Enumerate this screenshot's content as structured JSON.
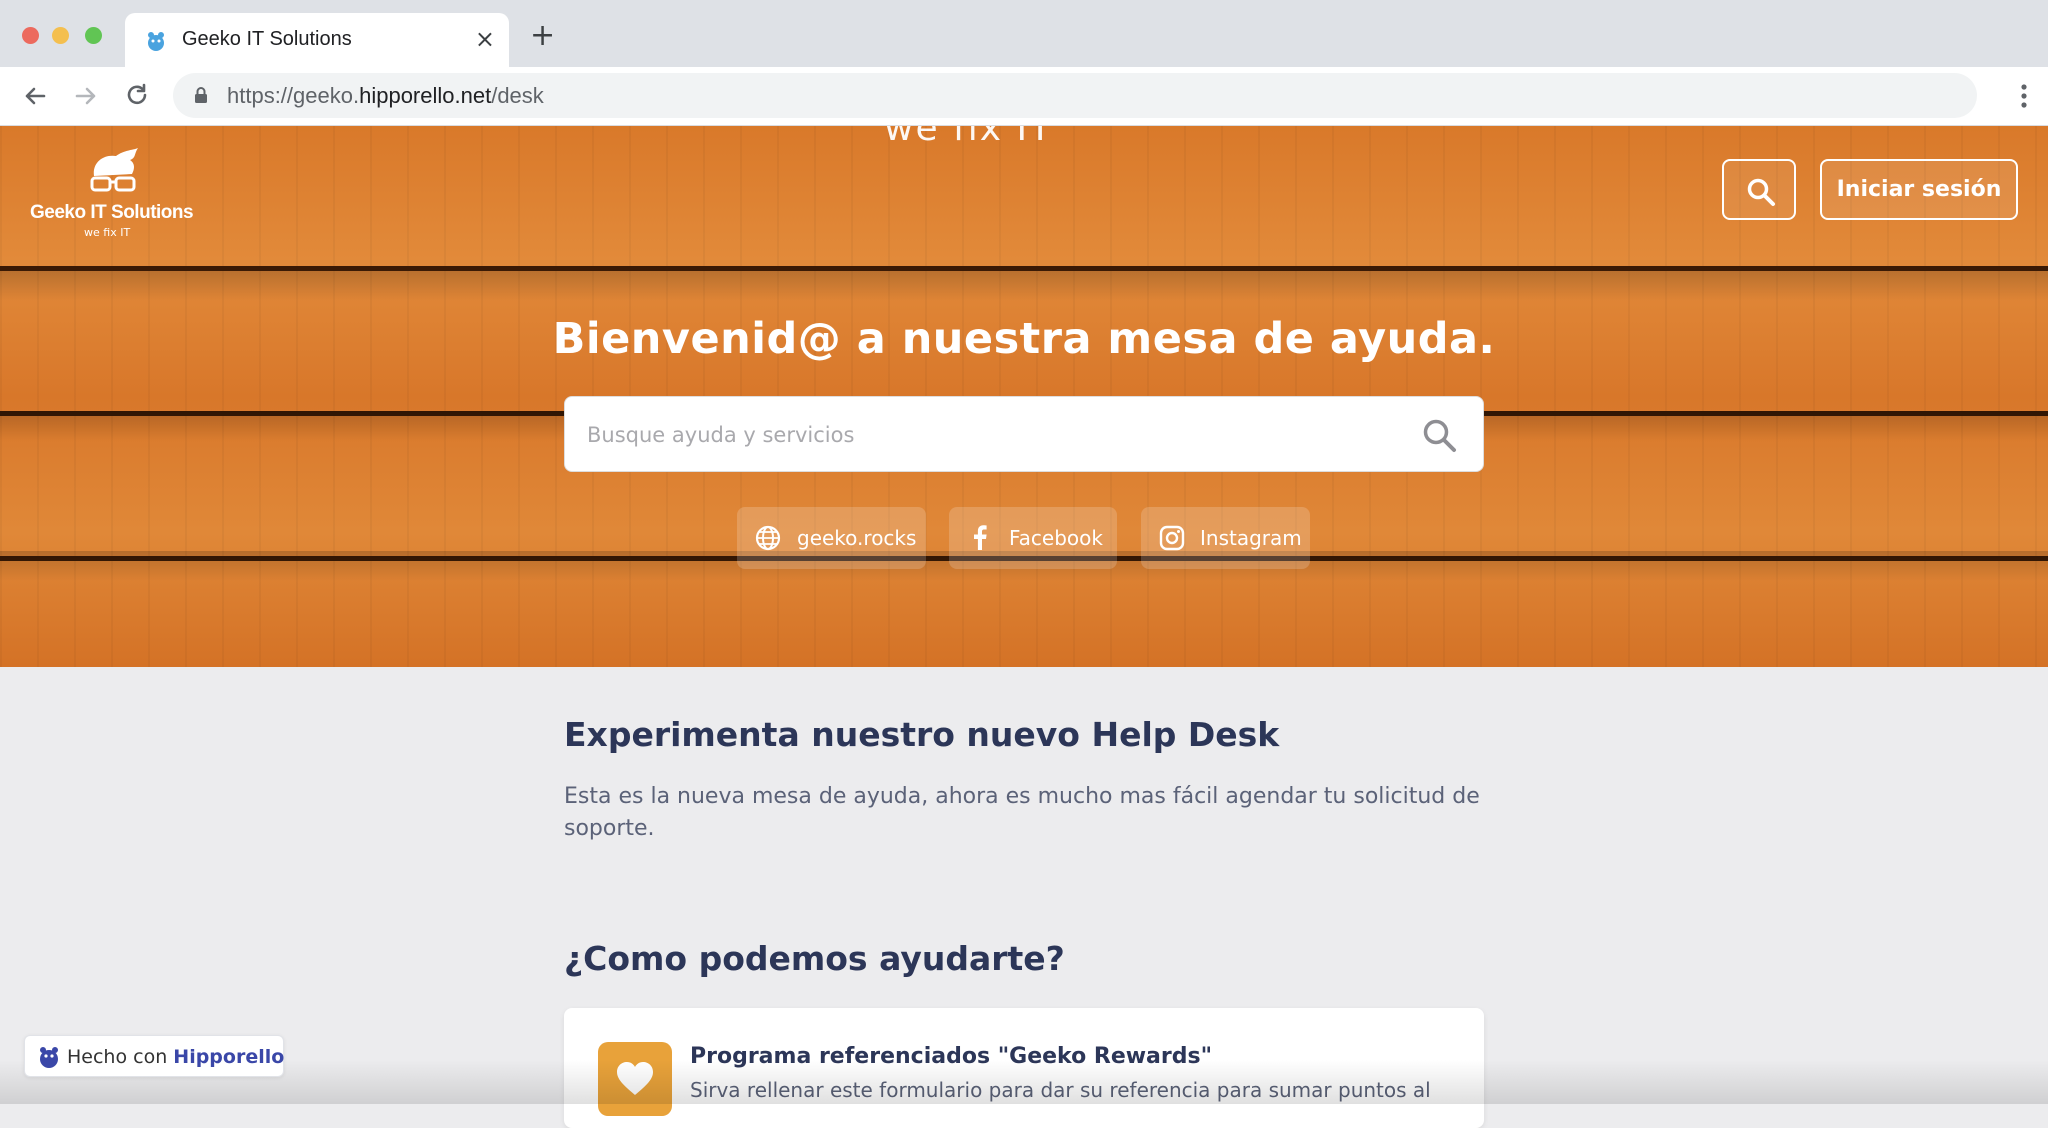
{
  "browser": {
    "tab_title": "Geeko IT Solutions",
    "tab_close": "×",
    "new_tab": "+",
    "url_prefix": "https://geeko.",
    "url_domain": "hipporello.net",
    "url_path": "/desk"
  },
  "header": {
    "slogan_top": "we fix IT",
    "logo_name": "Geeko IT Solutions",
    "logo_sub": "we fix IT",
    "login_label": "Iniciar sesión"
  },
  "hero": {
    "title": "Bienvenid@ a nuestra mesa de ayuda.",
    "search_placeholder": "Busque ayuda y servicios",
    "links": [
      {
        "label": "geeko.rocks",
        "icon": "globe-icon"
      },
      {
        "label": "Facebook",
        "icon": "facebook-icon"
      },
      {
        "label": "Instagram",
        "icon": "instagram-icon"
      }
    ]
  },
  "main": {
    "intro_heading": "Experimenta nuestro nuevo Help Desk",
    "intro_text": "Esta es la nueva mesa de ayuda, ahora es mucho mas fácil agendar tu solicitud de soporte.",
    "help_heading": "¿Como podemos ayudarte?",
    "cards": [
      {
        "title": "Programa referenciados \"Geeko Rewards\"",
        "desc": "Sirva rellenar este formulario para dar su referencia para sumar puntos al",
        "icon": "heart-icon"
      }
    ]
  },
  "badge": {
    "prefix": "Hecho con",
    "brand": "Hipporello"
  },
  "colors": {
    "accent": "#2c3658",
    "card_icon": "#e8a23a",
    "brand": "#3a47a8"
  }
}
